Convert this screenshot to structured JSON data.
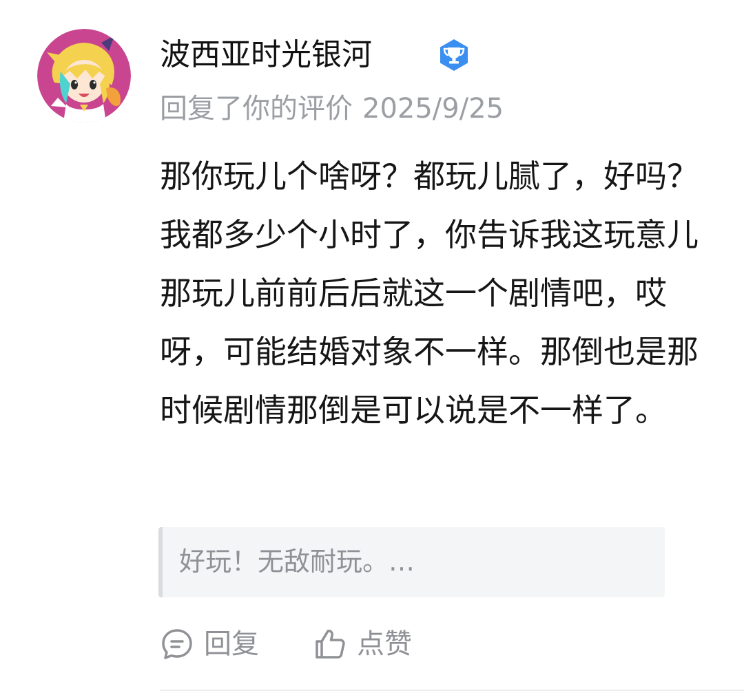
{
  "reply": {
    "username": "波西亚时光银河",
    "badge_icon": "trophy-badge-icon",
    "badge_color": "#3b8ff0",
    "action_text": "回复了你的评价",
    "date": "2025/9/25",
    "content": "那你玩儿个啥呀？都玩儿腻了，好吗？我都多少个小时了，你告诉我这玩意儿那玩儿前前后后就这一个剧情吧，哎呀，可能结婚对象不一样。那倒也是那时候剧情那倒是可以说是不一样了。",
    "quoted_review": "好玩！无敌耐玩。…"
  },
  "actions": {
    "reply_icon": "comment-bubble-icon",
    "reply_label": "回复",
    "like_icon": "thumbs-up-icon",
    "like_label": "点赞"
  },
  "colors": {
    "avatar_background": "#c9458f",
    "meta_gray": "#9b9ea3",
    "quote_background": "#f4f5f6"
  }
}
